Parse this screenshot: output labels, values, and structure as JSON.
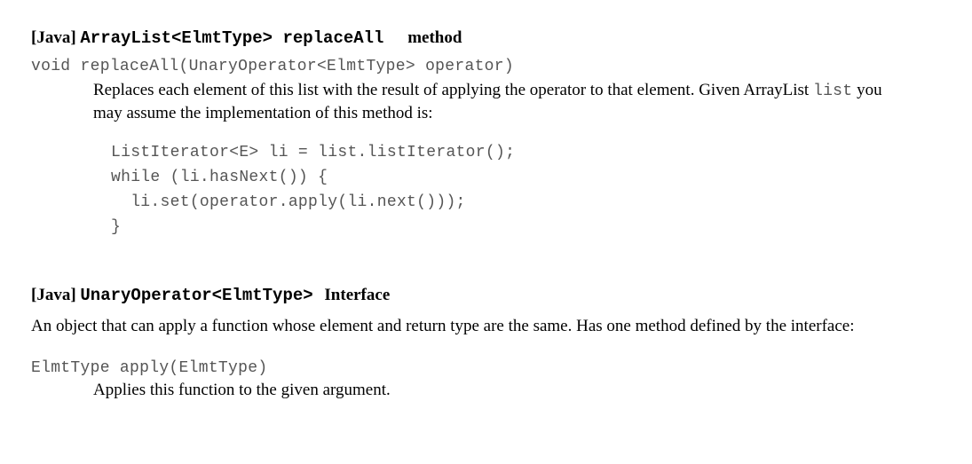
{
  "section1": {
    "lang_tag": "[Java]",
    "type_name": "ArrayList<ElmtType> replaceAll",
    "suffix": "method",
    "signature": "void replaceAll(UnaryOperator<ElmtType> operator)",
    "desc_part1": "Replaces each element of this list with the result of applying the operator to that element. Given ArrayList ",
    "desc_code": "list",
    "desc_part2": " you may assume the implementation of this method is:",
    "code_block": "ListIterator<E> li = list.listIterator();\nwhile (li.hasNext()) {\n  li.set(operator.apply(li.next()));\n}"
  },
  "section2": {
    "lang_tag": "[Java]",
    "type_name": "UnaryOperator<ElmtType>",
    "suffix": "Interface",
    "desc": "An object that can apply a function whose element and return type are the same.  Has one method defined by the interface:",
    "signature": "ElmtType apply(ElmtType)",
    "method_desc": "Applies this function to the given argument."
  }
}
